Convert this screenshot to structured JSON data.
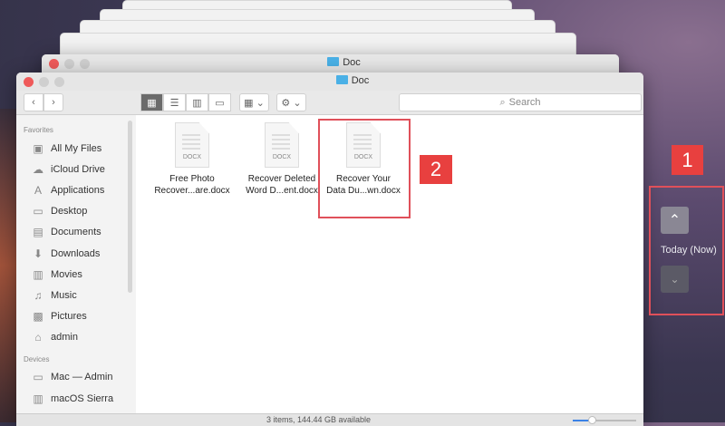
{
  "window": {
    "title": "Doc",
    "back_title": "Doc"
  },
  "toolbar": {
    "back": "‹",
    "forward": "›",
    "views": [
      "▦",
      "☰",
      "▥",
      "▭"
    ],
    "arrange": "▦ ⌄",
    "action": "⚙ ⌄",
    "search_placeholder": "Search",
    "search_icon": "⌕"
  },
  "sidebar": {
    "favorites_header": "Favorites",
    "favorites": [
      {
        "label": "All My Files",
        "icon": "▣"
      },
      {
        "label": "iCloud Drive",
        "icon": "☁"
      },
      {
        "label": "Applications",
        "icon": "A"
      },
      {
        "label": "Desktop",
        "icon": "▭"
      },
      {
        "label": "Documents",
        "icon": "▤"
      },
      {
        "label": "Downloads",
        "icon": "⬇"
      },
      {
        "label": "Movies",
        "icon": "▥"
      },
      {
        "label": "Music",
        "icon": "♫"
      },
      {
        "label": "Pictures",
        "icon": "▩"
      },
      {
        "label": "admin",
        "icon": "⌂"
      }
    ],
    "devices_header": "Devices",
    "devices": [
      {
        "label": "Mac — Admin",
        "icon": "▭"
      },
      {
        "label": "macOS Sierra",
        "icon": "▥"
      }
    ]
  },
  "files": [
    {
      "line1": "Free Photo",
      "line2": "Recover...are.docx",
      "ext": "DOCX"
    },
    {
      "line1": "Recover Deleted",
      "line2": "Word D...ent.docx",
      "ext": "DOCX"
    },
    {
      "line1": "Recover Your",
      "line2": "Data Du...wn.docx",
      "ext": "DOCX"
    }
  ],
  "status": {
    "text": "3 items, 144.44 GB available",
    "zoom_slider": 0.3
  },
  "timemachine": {
    "up": "⌃",
    "label": "Today (Now)",
    "down": "⌄"
  },
  "annotations": {
    "one": "1",
    "two": "2"
  },
  "colors": {
    "accent": "#e8403f"
  }
}
